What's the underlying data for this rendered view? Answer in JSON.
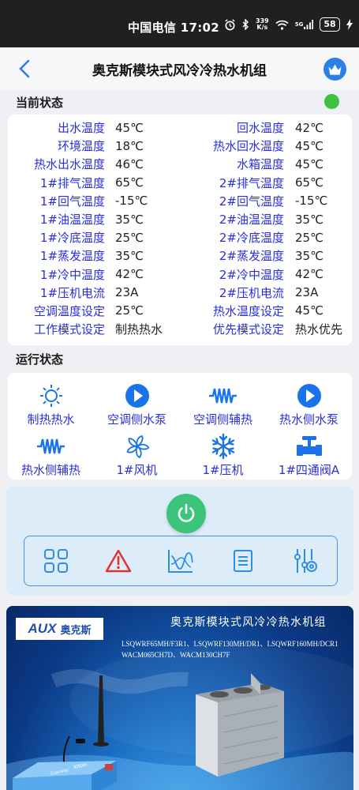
{
  "status_bar": {
    "carrier": "中国电信",
    "time": "17:02",
    "net_speed_value": "339",
    "net_speed_unit": "K/s",
    "signal_tag": "5G",
    "battery": "58"
  },
  "header": {
    "title": "奥克斯模块式风冷冷热水机组"
  },
  "current_status": {
    "heading": "当前状态",
    "indicator_color": "#3ec23e",
    "rows": [
      {
        "l1": "出水温度",
        "v1": "45℃",
        "l2": "回水温度",
        "v2": "42℃"
      },
      {
        "l1": "环境温度",
        "v1": "18℃",
        "l2": "热水回水温度",
        "v2": "45℃"
      },
      {
        "l1": "热水出水温度",
        "v1": "46℃",
        "l2": "水箱温度",
        "v2": "45℃"
      },
      {
        "l1": "1#排气温度",
        "v1": "65℃",
        "l2": "2#排气温度",
        "v2": "65℃"
      },
      {
        "l1": "1#回气温度",
        "v1": "-15℃",
        "l2": "2#回气温度",
        "v2": "-15℃"
      },
      {
        "l1": "1#油温温度",
        "v1": "35℃",
        "l2": "2#油温温度",
        "v2": "35℃"
      },
      {
        "l1": "1#冷底温度",
        "v1": "25℃",
        "l2": "2#冷底温度",
        "v2": "25℃"
      },
      {
        "l1": "1#蒸发温度",
        "v1": "35℃",
        "l2": "2#蒸发温度",
        "v2": "35℃"
      },
      {
        "l1": "1#冷中温度",
        "v1": "42℃",
        "l2": "2#冷中温度",
        "v2": "42℃"
      },
      {
        "l1": "1#压机电流",
        "v1": "23A",
        "l2": "2#压机电流",
        "v2": "23A"
      },
      {
        "l1": "空调温度设定",
        "v1": "25℃",
        "l2": "热水温度设定",
        "v2": "45℃"
      },
      {
        "l1": "工作模式设定",
        "v1": "制热热水",
        "l2": "优先模式设定",
        "v2": "热水优先"
      }
    ]
  },
  "run_status": {
    "heading": "运行状态",
    "items": [
      {
        "label": "制热热水",
        "icon": "sun-icon"
      },
      {
        "label": "空调侧水泵",
        "icon": "pump-icon"
      },
      {
        "label": "空调侧辅热",
        "icon": "heater-icon"
      },
      {
        "label": "热水侧水泵",
        "icon": "pump-icon"
      },
      {
        "label": "热水侧辅热",
        "icon": "heater-icon"
      },
      {
        "label": "1#风机",
        "icon": "fan-icon"
      },
      {
        "label": "1#压机",
        "icon": "snowflake-icon"
      },
      {
        "label": "1#四通阀A",
        "icon": "valve-icon"
      }
    ]
  },
  "controls": {
    "power_icon": "power-icon",
    "tools": [
      "grid-icon",
      "alarm-icon",
      "chart-icon",
      "list-icon",
      "settings-icon"
    ]
  },
  "banner": {
    "brand": "AUX",
    "brand_cn": "奥克斯",
    "title": "奥克斯模块式风冷冷热水机组",
    "model_line1": "LSQWRF65MH/F3R1、LSQWRF130MH/DR1、LSQWRF160MH/DCR1",
    "model_line2": "WACM065CH7D、WACM130CH7F",
    "gateway_brand": "lotcer",
    "gateway_label": "Gateway"
  },
  "colors": {
    "accent_blue": "#2a2fd8",
    "power_green": "#3cc47a",
    "alarm_red": "#e03030",
    "toolbar_border": "#3f96df",
    "crown_blue": "#2d7fe8"
  }
}
